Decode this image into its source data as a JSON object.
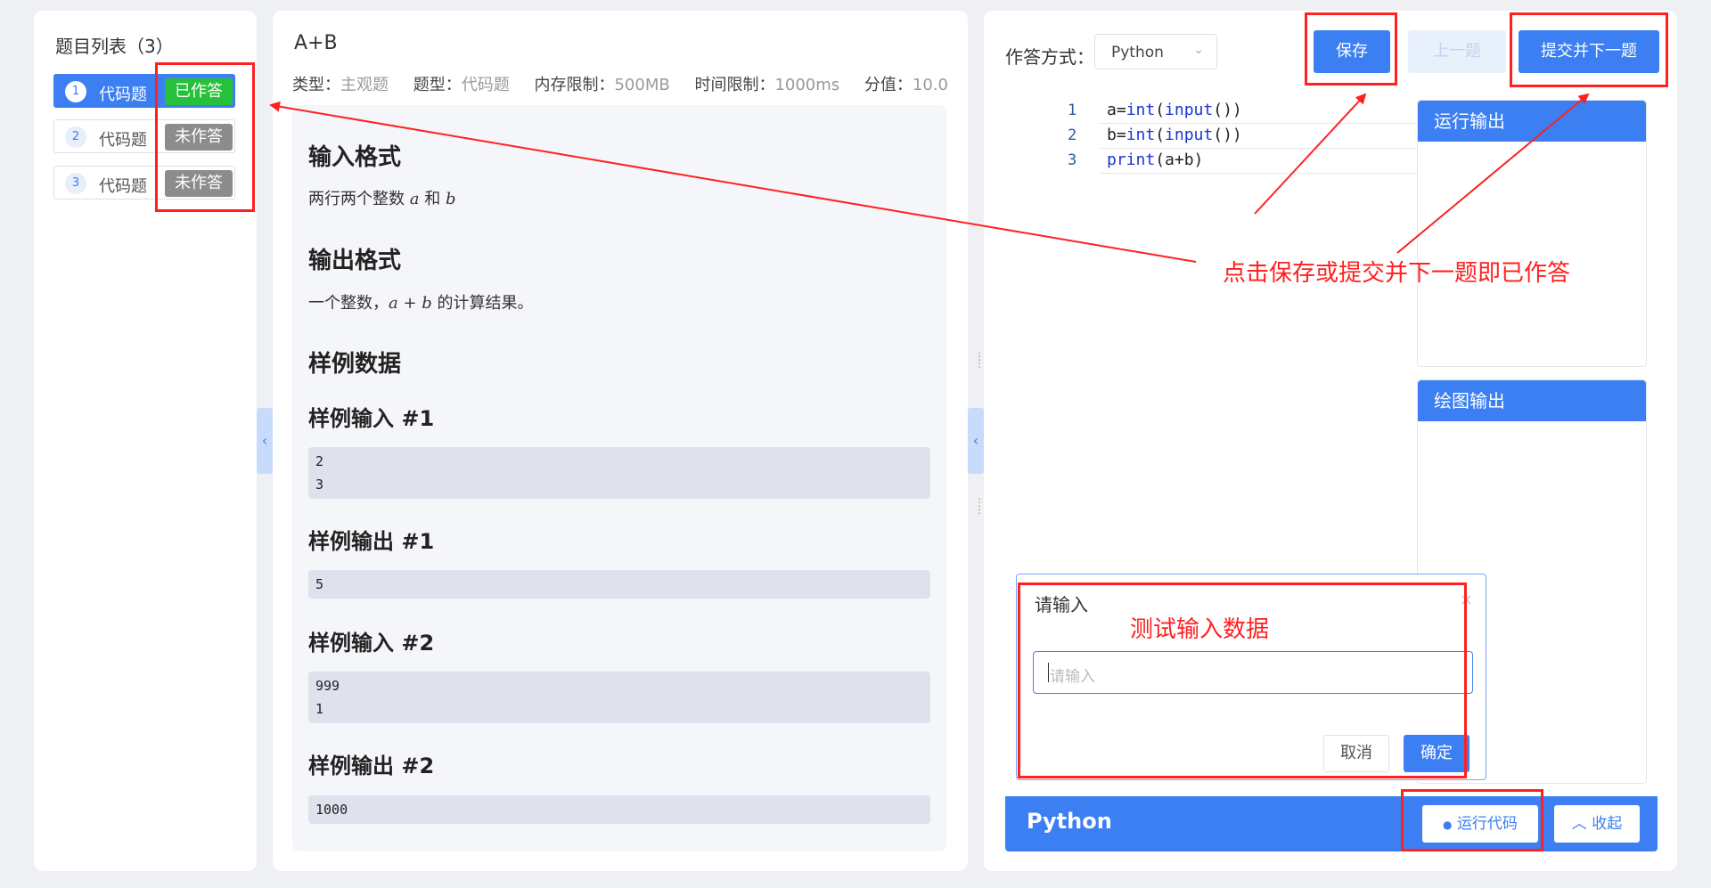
{
  "problem_list": {
    "title": "题目列表（3）",
    "items": [
      {
        "num": "1",
        "name": "代码题",
        "status": "已作答"
      },
      {
        "num": "2",
        "name": "代码题",
        "status": "未作答"
      },
      {
        "num": "3",
        "name": "代码题",
        "status": "未作答"
      }
    ]
  },
  "problem": {
    "title": "A+B",
    "meta": {
      "type_label": "类型：",
      "type_value": "主观题",
      "qtype_label": "题型：",
      "qtype_value": "代码题",
      "mem_label": "内存限制：",
      "mem_value": "500MB",
      "time_label": "时间限制：",
      "time_value": "1000ms",
      "score_label": "分值：",
      "score_value": "10.0"
    },
    "input_format_heading": "输入格式",
    "input_format_text": {
      "pre": "两行两个整数",
      "a": "a",
      "mid": "和",
      "b": "b"
    },
    "output_format_heading": "输出格式",
    "output_format_text": {
      "pre": "一个整数，",
      "expr": "a + b",
      "post": "的计算结果。"
    },
    "samples_heading": "样例数据",
    "samples": [
      {
        "heading": "样例输入 #1",
        "lines": [
          "2",
          "3"
        ]
      },
      {
        "heading": "样例输出 #1",
        "lines": [
          "5"
        ]
      },
      {
        "heading": "样例输入 #2",
        "lines": [
          "999",
          "1"
        ]
      },
      {
        "heading": "样例输出 #2",
        "lines": [
          "1000"
        ]
      }
    ]
  },
  "answer": {
    "mode_label": "作答方式：",
    "mode_value": "Python",
    "save_button": "保存",
    "prev_button": "上一题",
    "submit_next_button": "提交并下一题"
  },
  "editor": {
    "lines": [
      {
        "num": "1",
        "parts": [
          {
            "t": "a=",
            "k": false
          },
          {
            "t": "int",
            "k": true
          },
          {
            "t": "(",
            "k": false
          },
          {
            "t": "input",
            "k": true
          },
          {
            "t": "())",
            "k": false
          }
        ]
      },
      {
        "num": "2",
        "parts": [
          {
            "t": "b=",
            "k": false
          },
          {
            "t": "int",
            "k": true
          },
          {
            "t": "(",
            "k": false
          },
          {
            "t": "input",
            "k": true
          },
          {
            "t": "())",
            "k": false
          }
        ]
      },
      {
        "num": "3",
        "parts": [
          {
            "t": "print",
            "k": true
          },
          {
            "t": "(a+b)",
            "k": false
          }
        ]
      }
    ]
  },
  "run_output": {
    "title": "运行输出"
  },
  "draw_output": {
    "title": "绘图输出"
  },
  "input_dialog": {
    "title": "请输入",
    "close": "×",
    "placeholder": "请输入",
    "cancel": "取消",
    "confirm": "确定"
  },
  "bottom_bar": {
    "language": "Python",
    "run_button": "运行代码",
    "collapse_button": "收起"
  },
  "annotations": {
    "save_or_submit": "点击保存或提交并下一题即已作答",
    "test_input": "测试输入数据"
  },
  "icons": {
    "chevron_left": "‹",
    "chevron_down": "⌄",
    "run": "●",
    "collapse_up": "︿"
  },
  "colors": {
    "primary": "#3b7ff2",
    "answered": "#26c03a",
    "unanswered": "#8c8c8c",
    "annotation": "#ff2020"
  }
}
